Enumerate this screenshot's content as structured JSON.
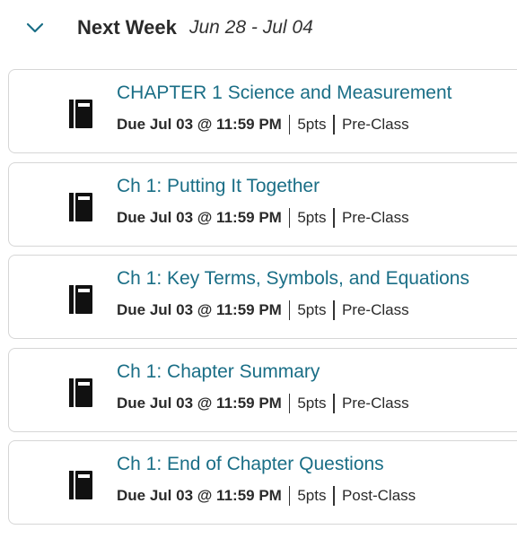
{
  "section": {
    "title": "Next Week",
    "date_range": "Jun 28 - Jul 04"
  },
  "assignments": [
    {
      "title": "CHAPTER 1 Science and Measurement",
      "due": "Due Jul 03 @ 11:59 PM",
      "points": "5pts",
      "type": "Pre-Class"
    },
    {
      "title": "Ch 1: Putting It Together",
      "due": "Due Jul 03 @ 11:59 PM",
      "points": "5pts",
      "type": "Pre-Class"
    },
    {
      "title": "Ch 1: Key Terms, Symbols, and Equations",
      "due": "Due Jul 03 @ 11:59 PM",
      "points": "5pts",
      "type": "Pre-Class"
    },
    {
      "title": "Ch 1: Chapter Summary",
      "due": "Due Jul 03 @ 11:59 PM",
      "points": "5pts",
      "type": "Pre-Class"
    },
    {
      "title": "Ch 1: End of Chapter Questions",
      "due": "Due Jul 03 @ 11:59 PM",
      "points": "5pts",
      "type": "Post-Class"
    }
  ],
  "icons": {
    "collapse": "chevron-down-icon",
    "assignment": "book-icon"
  },
  "colors": {
    "link": "#1a6e86",
    "border": "#d6d6d6"
  }
}
